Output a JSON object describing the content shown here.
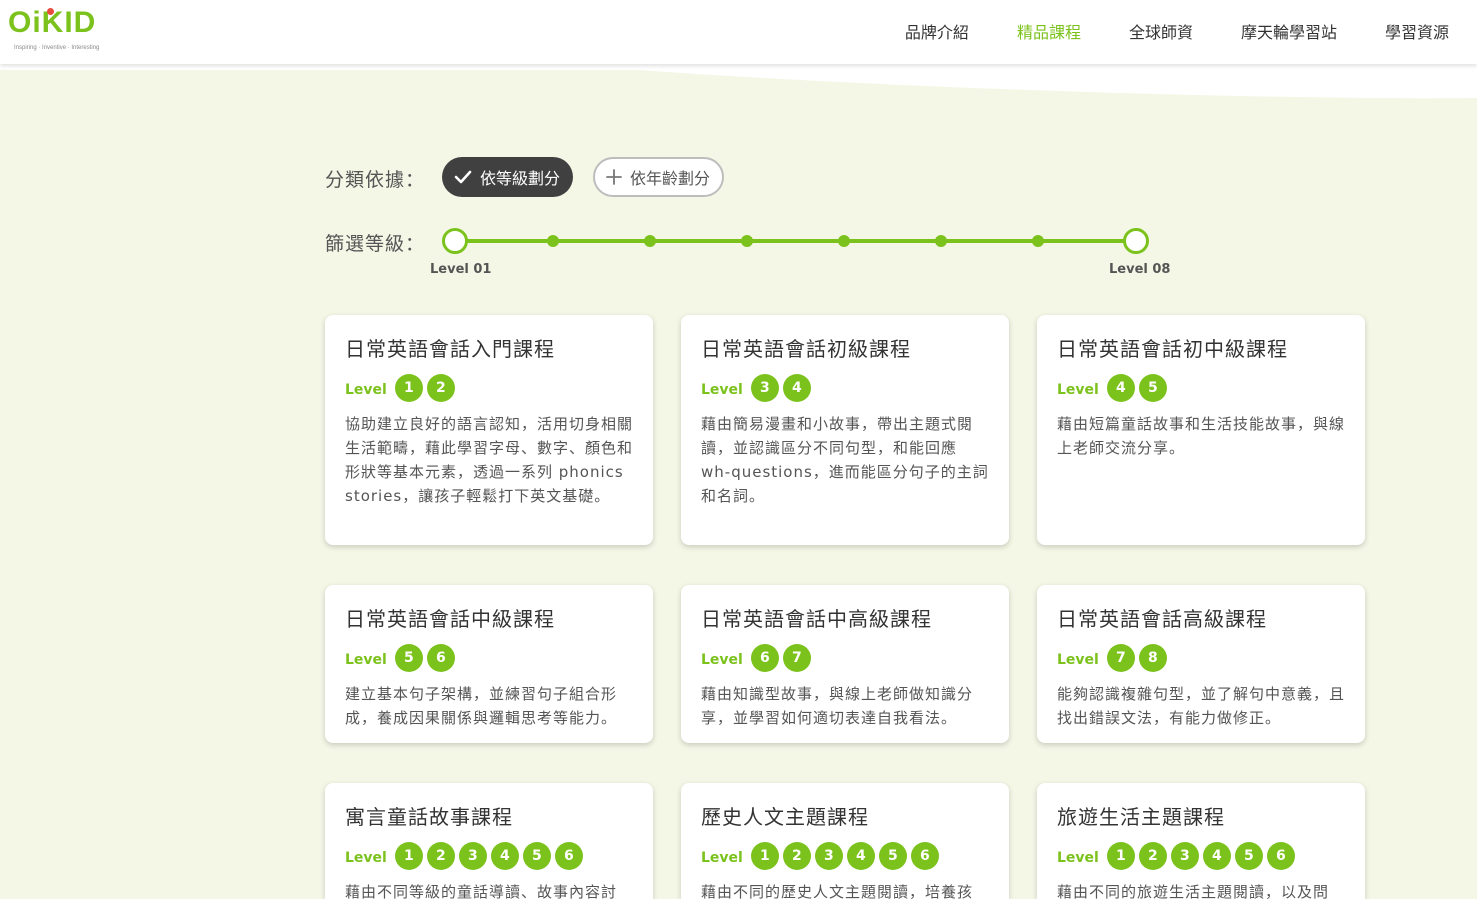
{
  "header": {
    "logo_text": "OiKID",
    "logo_tagline": "Inspiring · Inventive · Interesting",
    "nav": [
      {
        "label": "品牌介紹",
        "active": false
      },
      {
        "label": "精品課程",
        "active": true
      },
      {
        "label": "全球師資",
        "active": false
      },
      {
        "label": "摩天輪學習站",
        "active": false
      },
      {
        "label": "學習資源",
        "active": false
      }
    ]
  },
  "filter": {
    "category_label": "分類依據：",
    "by_level_label": "依等級劃分",
    "by_age_label": "依年齡劃分",
    "level_filter_label": "篩選等級：",
    "range_min_label": "Level 01",
    "range_max_label": "Level 08",
    "selected_range": [
      1,
      8
    ]
  },
  "level_word": "Level",
  "courses": [
    {
      "title": "日常英語會話入門課程",
      "levels": [
        "1",
        "2"
      ],
      "description": "協助建立良好的語言認知，活用切身相關生活範疇，藉此學習字母、數字、顏色和形狀等基本元素，透過一系列 phonics stories，讓孩子輕鬆打下英文基礎。"
    },
    {
      "title": "日常英語會話初級課程",
      "levels": [
        "3",
        "4"
      ],
      "description": "藉由簡易漫畫和小故事，帶出主題式閱讀，並認識區分不同句型，和能回應 wh-questions，進而能區分句子的主詞和名詞。"
    },
    {
      "title": "日常英語會話初中級課程",
      "levels": [
        "4",
        "5"
      ],
      "description": "藉由短篇童話故事和生活技能故事，與線上老師交流分享。"
    },
    {
      "title": "日常英語會話中級課程",
      "levels": [
        "5",
        "6"
      ],
      "description": "建立基本句子架構，並練習句子組合形成，養成因果關係與邏輯思考等能力。"
    },
    {
      "title": "日常英語會話中高級課程",
      "levels": [
        "6",
        "7"
      ],
      "description": "藉由知識型故事，與線上老師做知識分享，並學習如何適切表達自我看法。"
    },
    {
      "title": "日常英語會話高級課程",
      "levels": [
        "7",
        "8"
      ],
      "description": "能夠認識複雜句型，並了解句中意義，且找出錯誤文法，有能力做修正。"
    },
    {
      "title": "寓言童話故事課程",
      "levels": [
        "1",
        "2",
        "3",
        "4",
        "5",
        "6"
      ],
      "description": "藉由不同等級的童話導讀、故事內容討"
    },
    {
      "title": "歷史人文主題課程",
      "levels": [
        "1",
        "2",
        "3",
        "4",
        "5",
        "6"
      ],
      "description": "藉由不同的歷史人文主題閱讀，培養孩"
    },
    {
      "title": "旅遊生活主題課程",
      "levels": [
        "1",
        "2",
        "3",
        "4",
        "5",
        "6"
      ],
      "description": "藉由不同的旅遊生活主題閱讀，以及問"
    }
  ],
  "colors": {
    "accent": "#7cc21c",
    "dark_chip": "#404040",
    "background": "#f4f7e6"
  }
}
